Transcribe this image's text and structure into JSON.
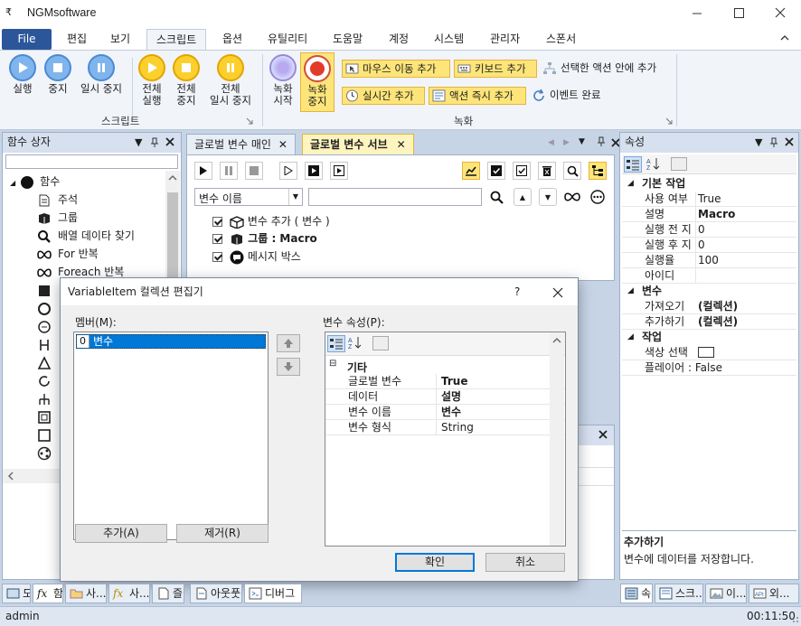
{
  "window": {
    "title": "NGMsoftware",
    "menu_glyph": "₹"
  },
  "ribbon_tabs": [
    "File",
    "편집",
    "보기",
    "스크립트",
    "옵션",
    "유틸리티",
    "도움말",
    "계정",
    "시스템",
    "관리자",
    "스폰서"
  ],
  "ribbon": {
    "script_group": "스크립트",
    "record_group": "녹화",
    "buttons": [
      {
        "l1": "실행",
        "l2": ""
      },
      {
        "l1": "중지",
        "l2": ""
      },
      {
        "l1": "일시 중지",
        "l2": ""
      },
      {
        "l1": "전체",
        "l2": "실행"
      },
      {
        "l1": "전체",
        "l2": "중지"
      },
      {
        "l1": "전체",
        "l2": "일시 중지"
      },
      {
        "l1": "녹화",
        "l2": "시작"
      },
      {
        "l1": "녹화",
        "l2": "중지"
      }
    ],
    "small": {
      "mouse": "마우스 이동 추가",
      "keyboard": "키보드 추가",
      "in_action": "선택한 액션 안에 추가",
      "realtime": "실시간 추가",
      "instant": "액션 즉시 추가",
      "event": "이벤트 완료"
    }
  },
  "left_pane": {
    "title": "함수 상자",
    "root": "함수",
    "items": [
      "주석",
      "그룹",
      "배열 데이타 찾기",
      "For 반복",
      "Foreach 반복"
    ]
  },
  "doc_tabs": [
    "글로벌 변수 매인",
    "글로벌 변수 서브"
  ],
  "editor": {
    "combo": "변수 이름",
    "search_value": "",
    "tree": [
      "변수 추가 ( 변수 )",
      "그룹 : Macro",
      "메시지 박스"
    ]
  },
  "props": {
    "title": "속성",
    "cats": {
      "basic": "기본 작업",
      "var": "변수",
      "work": "작업"
    },
    "rows": [
      {
        "k": "사용 여부",
        "v": "True",
        "b": false
      },
      {
        "k": "설명",
        "v": "Macro",
        "b": true
      },
      {
        "k": "실행 전 지",
        "v": "0",
        "b": false
      },
      {
        "k": "실행 후 지",
        "v": "0",
        "b": false
      },
      {
        "k": "실행율",
        "v": "100",
        "b": false
      },
      {
        "k": "아이디",
        "v": "",
        "b": false
      }
    ],
    "var_rows": [
      {
        "k": "가져오기",
        "v": "(컬렉션)",
        "b": true
      },
      {
        "k": "추가하기",
        "v": "(컬렉션)",
        "b": true
      }
    ],
    "work_rows": [
      {
        "k": "색상 선택",
        "v": "",
        "b": false
      },
      {
        "k": "플레이어 : False",
        "v": "",
        "b": false
      }
    ],
    "desc_title": "추가하기",
    "desc_text": "변수에 데이터를 저장합니다."
  },
  "dialog": {
    "title": "VariableItem 컬렉션 편집기",
    "help": "?",
    "members_label": "멤버(M):",
    "member_index": "0",
    "member_name": "변수",
    "props_label": "변수 속성(P):",
    "category": "기타",
    "rows": [
      {
        "k": "글로벌 변수",
        "v": "True",
        "b": true
      },
      {
        "k": "데이터",
        "v": "설명",
        "b": true
      },
      {
        "k": "변수 이름",
        "v": "변수",
        "b": true
      },
      {
        "k": "변수 형식",
        "v": "String",
        "b": false
      }
    ],
    "add": "추가(A)",
    "remove": "제거(R)",
    "ok": "확인",
    "cancel": "취소"
  },
  "bottom_tabs_left": [
    "도",
    "함",
    "사...",
    "사...",
    "즐",
    "아웃풋",
    "디버그"
  ],
  "bottom_tabs_right": [
    "속",
    "스크...",
    "이...",
    "외..."
  ],
  "status": {
    "user": "admin",
    "time": "00:11:50"
  },
  "colors": {
    "accent": "#2b579a",
    "highlight": "#fde57a",
    "ribbon": "#f1f4f9",
    "frame": "#c6d4e6"
  }
}
